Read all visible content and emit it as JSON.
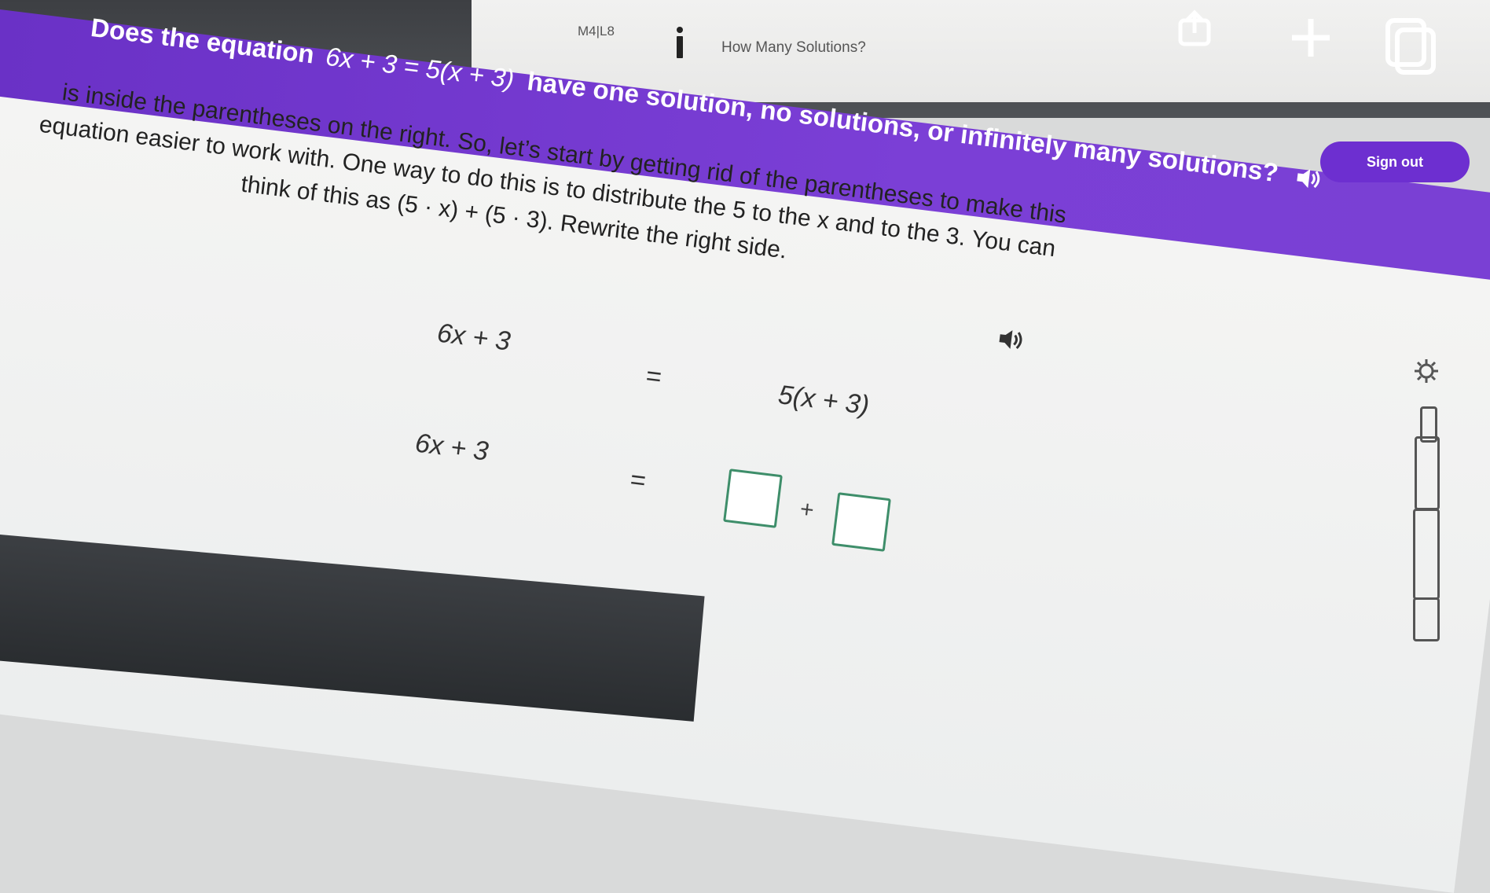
{
  "header": {
    "lesson_code": "M4|L8",
    "lesson_title": "How Many Solutions?",
    "sign_out_label": "Sign out",
    "icons": [
      "share-icon",
      "plus-icon",
      "window-icon",
      "info-icon"
    ]
  },
  "question": {
    "prefix": "Does the equation",
    "equation": "6x + 3 = 5(x + 3)",
    "suffix": "have one solution, no solutions, or infinitely many solutions?"
  },
  "instruction": {
    "line1": "is inside the parentheses on the right. So, let’s start by getting rid of the parentheses to make this",
    "line2": "equation easier to work with. One way to do this is to distribute the 5 to the x and to the 3. You can",
    "line3": "think of this as (5 · x) + (5 · 3). Rewrite the right side."
  },
  "equations": {
    "row1": {
      "left": "6x + 3",
      "equals": "=",
      "right": "5(x + 3)"
    },
    "row2": {
      "left": "6x + 3",
      "equals": "=",
      "plus": "+"
    }
  },
  "colors": {
    "banner": "#7138cc",
    "sign_out": "#6d2fd0",
    "blank_border": "#3e8e6a"
  }
}
